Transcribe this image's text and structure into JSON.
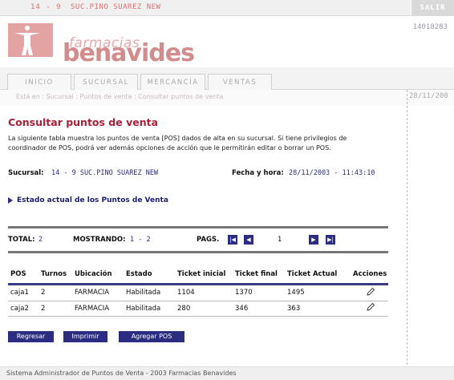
{
  "topbar": {
    "store_code": "14 - 9",
    "store_name": "SUC.PINO SUAREZ NEW",
    "logout": "SALIR"
  },
  "brand": {
    "line1": "farmacias",
    "line2": "benavides",
    "order_number": "14018283"
  },
  "tabs": [
    "INICIO",
    "SUCURSAL",
    "MERCANCÍA",
    "VENTAS"
  ],
  "breadcrumb": {
    "text": "Está en : Sucursal : Puntos de venta : Consultar puntos de venta",
    "date": "28/11/200"
  },
  "page": {
    "title": "Consultar puntos de venta",
    "intro": "La siguiente tabla muestra los puntos de venta [POS] dados de alta en su sucursal. Si tiene privilegios de coordinador de POS, podrá ver además opciones de acción que le permitirán editar o borrar un POS.",
    "branch_label": "Sucursal:",
    "branch_value": "14 - 9  SUC.PINO SUAREZ NEW",
    "datetime_label": "Fecha y hora:",
    "datetime_value": "28/11/2003 - 11:43:10",
    "section_title": "Estado actual de los Puntos de Venta"
  },
  "pagination": {
    "total_label": "TOTAL:",
    "total_value": "2",
    "showing_label": "MOSTRANDO:",
    "showing_value": "1 - 2",
    "pages_label": "PAGS.",
    "current_page": "1"
  },
  "table": {
    "headers": [
      "POS",
      "Turnos",
      "Ubicación",
      "Estado",
      "Ticket inicial",
      "Ticket final",
      "Ticket Actual",
      "Acciones"
    ],
    "rows": [
      [
        "caja1",
        "2",
        "FARMACIA",
        "Habilitada",
        "1104",
        "1370",
        "1495"
      ],
      [
        "caja2",
        "2",
        "FARMACIA",
        "Habilitada",
        "280",
        "346",
        "363"
      ]
    ]
  },
  "buttons": {
    "back": "Regresar",
    "print": "Imprimir",
    "add": "Agregar POS"
  },
  "footer": "Sistema Administrador de Puntos de Venta - 2003 Farmacias Benavides",
  "colors": {
    "accent": "#a8203a",
    "navy": "#2c2c80",
    "brand_pink": "#d48b8b"
  }
}
